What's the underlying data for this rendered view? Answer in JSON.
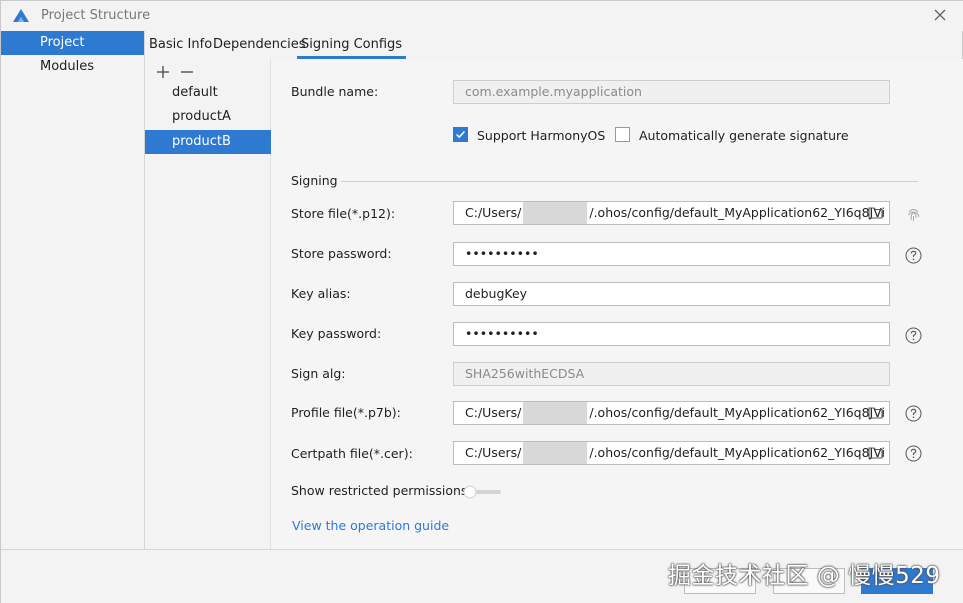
{
  "window": {
    "title": "Project Structure"
  },
  "nav": {
    "items": [
      {
        "label": "Project",
        "active": true
      },
      {
        "label": "Modules",
        "active": false
      }
    ]
  },
  "tabs": [
    {
      "label": "Basic Info"
    },
    {
      "label": "Dependencies"
    },
    {
      "label": "Signing Configs",
      "active": true
    }
  ],
  "configs": {
    "items": [
      {
        "label": "default"
      },
      {
        "label": "productA"
      },
      {
        "label": "productB",
        "active": true
      }
    ]
  },
  "form": {
    "bundle_name_label": "Bundle name:",
    "bundle_name_value": "com.example.myapplication",
    "support_harmonyos_label": "Support HarmonyOS",
    "support_harmonyos_checked": true,
    "auto_sign_label": "Automatically generate signature",
    "auto_sign_checked": false,
    "signing_section": "Signing",
    "store_file_label": "Store file(*.p12):",
    "store_file_prefix": "C:/Users/",
    "store_file_suffix": "/.ohos/config/default_MyApplication62_YI6q8JVi",
    "store_password_label": "Store password:",
    "store_password_value": "••••••••••",
    "key_alias_label": "Key alias:",
    "key_alias_value": "debugKey",
    "key_password_label": "Key password:",
    "key_password_value": "••••••••••",
    "sign_alg_label": "Sign alg:",
    "sign_alg_value": "SHA256withECDSA",
    "profile_file_label": "Profile file(*.p7b):",
    "profile_file_prefix": "C:/Users/",
    "profile_file_suffix": "/.ohos/config/default_MyApplication62_YI6q8JVi",
    "certpath_file_label": "Certpath file(*.cer):",
    "certpath_file_prefix": "C:/Users/",
    "certpath_file_suffix": "/.ohos/config/default_MyApplication62_YI6q8JVi",
    "restricted_label": "Show restricted permissions",
    "restricted_on": false,
    "guide_link": "View the operation guide"
  },
  "watermark": "掘金技术社区 @ 慢慢529",
  "colors": {
    "accent": "#2f7ad1",
    "background": "#f3f3f3"
  }
}
